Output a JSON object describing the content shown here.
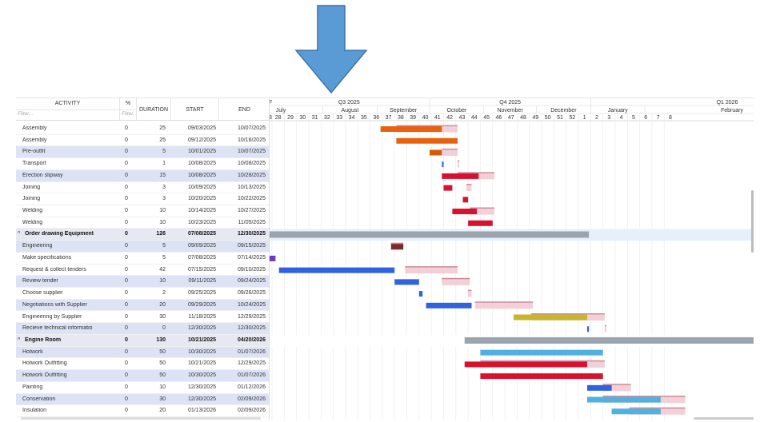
{
  "columns": {
    "activity": "ACTIVITY",
    "activity_filter": "Filter...",
    "pct": "%",
    "pct_filter": "Filter.",
    "duration": "DURATION",
    "start": "START",
    "end": "END"
  },
  "timeline": {
    "quarters": [
      "Q3 2025",
      "Q4 2025",
      "Q1 2026"
    ],
    "months": [
      "July",
      "August",
      "September",
      "October",
      "November",
      "December",
      "January",
      "February"
    ],
    "weeks": [
      "28",
      "29",
      "30",
      "31",
      "32",
      "33",
      "34",
      "35",
      "36",
      "37",
      "38",
      "39",
      "40",
      "41",
      "42",
      "43",
      "44",
      "45",
      "46",
      "47",
      "48",
      "49",
      "50",
      "51",
      "52",
      "1",
      "2",
      "3",
      "4",
      "5",
      "6",
      "7",
      "8"
    ],
    "week_edge_label": "8",
    "quarter_edge_label": "F"
  },
  "rows": [
    {
      "name": "Assembly",
      "pct": "0",
      "duration": "25",
      "start": "09/03/2025",
      "end": "10/07/2025",
      "type": "task"
    },
    {
      "name": "Assembly",
      "pct": "0",
      "duration": "25",
      "start": "09/12/2025",
      "end": "10/16/2025",
      "type": "task"
    },
    {
      "name": "Pre-outfit",
      "pct": "0",
      "duration": "5",
      "start": "10/01/2025",
      "end": "10/07/2025",
      "type": "task"
    },
    {
      "name": "Transport",
      "pct": "0",
      "duration": "1",
      "start": "10/08/2025",
      "end": "10/08/2025",
      "type": "task"
    },
    {
      "name": "Erection slipway",
      "pct": "0",
      "duration": "15",
      "start": "10/08/2025",
      "end": "10/28/2025",
      "type": "task"
    },
    {
      "name": "Joining",
      "pct": "0",
      "duration": "3",
      "start": "10/09/2025",
      "end": "10/13/2025",
      "type": "task"
    },
    {
      "name": "Joining",
      "pct": "0",
      "duration": "3",
      "start": "10/20/2025",
      "end": "10/22/2025",
      "type": "task"
    },
    {
      "name": "Welding",
      "pct": "0",
      "duration": "10",
      "start": "10/14/2025",
      "end": "10/27/2025",
      "type": "task"
    },
    {
      "name": "Welding",
      "pct": "0",
      "duration": "10",
      "start": "10/23/2025",
      "end": "11/05/2025",
      "type": "task"
    },
    {
      "name": "Order drawing Equipment",
      "pct": "0",
      "duration": "126",
      "start": "07/08/2025",
      "end": "12/30/2025",
      "type": "summary",
      "chevron": "^"
    },
    {
      "name": "Engineering",
      "pct": "0",
      "duration": "5",
      "start": "09/09/2025",
      "end": "09/15/2025",
      "type": "task"
    },
    {
      "name": "Make specifications",
      "pct": "0",
      "duration": "5",
      "start": "07/08/2025",
      "end": "07/14/2025",
      "type": "task"
    },
    {
      "name": "Request & collect tenders",
      "pct": "0",
      "duration": "42",
      "start": "07/15/2025",
      "end": "09/10/2025",
      "type": "task"
    },
    {
      "name": "Review tender",
      "pct": "0",
      "duration": "10",
      "start": "09/11/2025",
      "end": "09/24/2025",
      "type": "task"
    },
    {
      "name": "Choose supplier",
      "pct": "0",
      "duration": "2",
      "start": "09/25/2025",
      "end": "09/26/2025",
      "type": "task"
    },
    {
      "name": "Negotiations with Supplier",
      "pct": "0",
      "duration": "20",
      "start": "09/29/2025",
      "end": "10/24/2025",
      "type": "task"
    },
    {
      "name": "Engineering by Supplier",
      "pct": "0",
      "duration": "30",
      "start": "11/18/2025",
      "end": "12/29/2025",
      "type": "task"
    },
    {
      "name": "Recieve technical informatio",
      "pct": "0",
      "duration": "0",
      "start": "12/30/2025",
      "end": "12/30/2025",
      "type": "task"
    },
    {
      "name": "Engine Room",
      "pct": "0",
      "duration": "130",
      "start": "10/21/2025",
      "end": "04/20/2026",
      "type": "summary",
      "chevron": "^"
    },
    {
      "name": "Hotwork",
      "pct": "0",
      "duration": "50",
      "start": "10/30/2025",
      "end": "01/07/2026",
      "type": "task"
    },
    {
      "name": "Hotwork Outfitting",
      "pct": "0",
      "duration": "50",
      "start": "10/21/2025",
      "end": "12/29/2025",
      "type": "task"
    },
    {
      "name": "Hotwork Outfitting",
      "pct": "0",
      "duration": "50",
      "start": "10/30/2025",
      "end": "01/07/2026",
      "type": "task"
    },
    {
      "name": "Painting",
      "pct": "0",
      "duration": "10",
      "start": "12/30/2025",
      "end": "01/12/2026",
      "type": "task"
    },
    {
      "name": "Conservation",
      "pct": "0",
      "duration": "30",
      "start": "12/30/2025",
      "end": "02/09/2026",
      "type": "task"
    },
    {
      "name": "Insulation",
      "pct": "0",
      "duration": "20",
      "start": "01/13/2026",
      "end": "02/09/2026",
      "type": "task"
    }
  ],
  "bars": [
    {
      "start": "09/03/2025",
      "end": "10/07/2025",
      "color": "#e8620e",
      "baseline": {
        "start": "09/12/2025",
        "end": "10/16/2025"
      }
    },
    {
      "start": "09/12/2025",
      "end": "10/16/2025",
      "color": "#e8620e"
    },
    {
      "start": "10/01/2025",
      "end": "10/07/2025",
      "color": "#d45a0a",
      "baseline": {
        "start": "10/08/2025",
        "end": "10/16/2025"
      }
    },
    {
      "start": "10/08/2025",
      "end": "10/08/2025",
      "color": "#3b6be0",
      "baseline": {
        "start": "10/17/2025",
        "end": "10/17/2025"
      }
    },
    {
      "start": "10/08/2025",
      "end": "10/28/2025",
      "color": "#d8112f",
      "baseline": {
        "start": "10/17/2025",
        "end": "11/06/2025"
      }
    },
    {
      "start": "10/09/2025",
      "end": "10/13/2025",
      "color": "#d8112f",
      "baseline": {
        "start": "10/22/2025",
        "end": "10/24/2025"
      }
    },
    {
      "start": "10/20/2025",
      "end": "10/22/2025",
      "color": "#d8112f"
    },
    {
      "start": "10/14/2025",
      "end": "10/27/2025",
      "color": "#d8112f",
      "baseline": {
        "start": "10/24/2025",
        "end": "11/06/2025"
      }
    },
    {
      "start": "10/23/2025",
      "end": "11/05/2025",
      "color": "#d8112f"
    },
    {
      "start": "07/01/2025",
      "end": "12/30/2025",
      "color": "#9aa3ae",
      "summary": true
    },
    {
      "start": "09/09/2025",
      "end": "09/15/2025",
      "color": "#7d2a2a",
      "baseline": {
        "start": "09/09/2025",
        "end": "09/15/2025"
      }
    },
    {
      "start": "07/01/2025",
      "end": "07/04/2025",
      "color": "#6a3bbd"
    },
    {
      "start": "07/07/2025",
      "end": "09/10/2025",
      "color": "#2f62e0",
      "baseline": {
        "start": "09/17/2025",
        "end": "10/16/2025"
      }
    },
    {
      "start": "09/11/2025",
      "end": "09/24/2025",
      "color": "#2f62e0",
      "baseline": {
        "start": "10/08/2025",
        "end": "10/23/2025"
      }
    },
    {
      "start": "09/25/2025",
      "end": "09/26/2025",
      "color": "#2f62e0",
      "baseline": {
        "start": "10/23/2025",
        "end": "10/24/2025"
      }
    },
    {
      "start": "09/29/2025",
      "end": "10/24/2025",
      "color": "#2f62e0",
      "baseline": {
        "start": "10/27/2025",
        "end": "11/28/2025"
      }
    },
    {
      "start": "11/18/2025",
      "end": "12/29/2025",
      "color": "#c8b52a",
      "baseline": {
        "start": "11/28/2025",
        "end": "01/08/2026"
      }
    },
    {
      "start": "12/30/2025",
      "end": "12/30/2025",
      "color": "#2f62e0",
      "baseline": {
        "start": "01/09/2026",
        "end": "01/09/2026"
      }
    },
    {
      "start": "10/21/2025",
      "end": "04/20/2026",
      "color": "#9aa3ae",
      "summary": true
    },
    {
      "start": "10/30/2025",
      "end": "01/07/2026",
      "color": "#4fb1e0"
    },
    {
      "start": "10/21/2025",
      "end": "12/29/2025",
      "color": "#d8112f",
      "baseline": {
        "start": "10/30/2025",
        "end": "01/08/2026"
      }
    },
    {
      "start": "10/30/2025",
      "end": "01/07/2026",
      "color": "#d8112f"
    },
    {
      "start": "12/30/2025",
      "end": "01/12/2026",
      "color": "#2f62e0",
      "baseline": {
        "start": "01/08/2026",
        "end": "01/23/2026"
      }
    },
    {
      "start": "12/30/2025",
      "end": "02/09/2026",
      "color": "#4fb1e0",
      "baseline": {
        "start": "01/08/2026",
        "end": "02/23/2026"
      }
    },
    {
      "start": "01/13/2026",
      "end": "02/09/2026",
      "color": "#4fb1e0",
      "baseline": {
        "start": "01/23/2026",
        "end": "02/23/2026"
      }
    }
  ],
  "colors": {
    "arrow": "#5b9bd5",
    "baseline": "#f1c7d0",
    "baseline_top": "#c9899a",
    "summary_highlight": "#e6f0fb"
  }
}
